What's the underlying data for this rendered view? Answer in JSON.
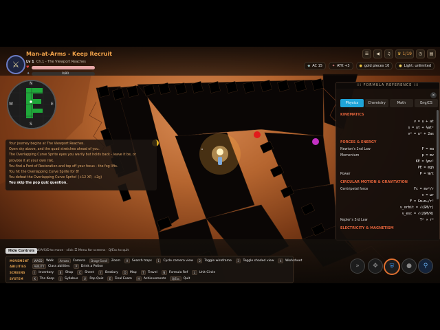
{
  "header": {
    "title": "Man-at-Arms - Keep Recruit",
    "level": "Lv 1",
    "chapter": "Ch.1 - The Viewport Reaches",
    "hp_value": "",
    "xp_value": "0/80",
    "hp_fraction": 1.0,
    "xp_fraction": 0.0,
    "colors": {
      "hp": "#e8a7a7",
      "xp": "#a9c7e0",
      "accent": "#f0a24a"
    }
  },
  "top_icons": [
    {
      "icon": "menu-icon",
      "label": ""
    },
    {
      "icon": "sound-icon",
      "label": ""
    },
    {
      "icon": "music-icon",
      "label": ""
    },
    {
      "icon": "trophy-icon",
      "label": "1/19"
    },
    {
      "icon": "clock-icon",
      "label": ""
    },
    {
      "icon": "book-icon",
      "label": ""
    }
  ],
  "stats": [
    {
      "icon": "shield-icon",
      "label": "AC 15"
    },
    {
      "icon": "sword-icon",
      "label": "ATK +3"
    },
    {
      "icon": "coin-icon",
      "label": "gold pieces 10"
    },
    {
      "icon": "lightbulb-icon",
      "label": "Light: unlimited"
    }
  ],
  "minimap": {
    "n": "N",
    "s": "S",
    "w": "W",
    "e": "E"
  },
  "log": [
    "Your journey begins at The Viewport Reaches.",
    "Open sky above, and the quad stretches ahead of you.",
    "The Overlapping Curve Sprite eyes you warily but holds back - leave it be, or",
    "provoke it at your own risk.",
    "You find a Font of Restoration and top off your focus - the fog lifts.",
    "You hit the Overlapping Curve Sprite for 8!",
    "You defeat the Overlapping Curve Sprite! (+12 XP, +2g)",
    "You skip the pop quiz question."
  ],
  "formula": {
    "header": "FORMULA REFERENCE",
    "close": "×",
    "tabs": [
      "Physics",
      "Chemistry",
      "Math",
      "Eng/CS"
    ],
    "active_tab": 0,
    "sections": [
      {
        "title": "KINEMATICS",
        "rows": [
          {
            "name": "",
            "formula": "v = u + at"
          },
          {
            "name": "",
            "formula": "s = ut + ½at²"
          },
          {
            "name": "",
            "formula": "v² = u² + 2as"
          }
        ]
      },
      {
        "title": "FORCES & ENERGY",
        "rows": [
          {
            "name": "Newton's 2nd Law",
            "formula": "F = ma"
          },
          {
            "name": "Momentum",
            "formula": "p = mv"
          },
          {
            "name": "",
            "formula": "KE = ½mv²"
          },
          {
            "name": "",
            "formula": "PE = mgh"
          },
          {
            "name": "Power",
            "formula": "P = W/t"
          }
        ]
      },
      {
        "title": "CIRCULAR MOTION & GRAVITATION",
        "rows": [
          {
            "name": "Centripetal force",
            "formula": "Fc = mv²/r"
          },
          {
            "name": "",
            "formula": "v = ωr"
          },
          {
            "name": "",
            "formula": "F = Gm₁m₂/r²"
          },
          {
            "name": "",
            "formula": "v_orbit = √(GM/r)"
          },
          {
            "name": "",
            "formula": "v_esc = √(2GM/R)"
          },
          {
            "name": "Kepler's 3rd Law",
            "formula": "T² ∝ r³"
          }
        ]
      },
      {
        "title": "ELECTRICITY & MAGNETISM",
        "rows": []
      }
    ]
  },
  "bottom": {
    "hide_controls": "Hide Controls",
    "hint": "W/A/S/D to move · click ☰ Menu for screens · Q/Esc to quit",
    "rows": [
      {
        "category": "MOVEMENT",
        "items": [
          {
            "key": "WASD",
            "action": "Walk"
          },
          {
            "key": "Arrows",
            "action": "Camera"
          },
          {
            "key": "Drag+Scroll",
            "action": "Zoom"
          },
          {
            "key": "X",
            "action": "Search traps"
          },
          {
            "key": "1",
            "action": "Cycle camera view"
          },
          {
            "key": "2",
            "action": "Toggle wireframe"
          },
          {
            "key": "3",
            "action": "Toggle shaded view"
          },
          {
            "key": "4",
            "action": "Worksheet"
          }
        ]
      },
      {
        "category": "ABILITIES",
        "items": [
          {
            "key": "ABILITY",
            "action": "Class abilities"
          },
          {
            "key": "P",
            "action": "Drink a Potion"
          }
        ]
      },
      {
        "category": "SCREENS",
        "items": [
          {
            "key": "I",
            "action": "Inventory"
          },
          {
            "key": "B",
            "action": "Shop"
          },
          {
            "key": "C",
            "action": "Sheet"
          },
          {
            "key": "Y",
            "action": "Bestiary"
          },
          {
            "key": "O",
            "action": "Map"
          },
          {
            "key": "T",
            "action": "Travel"
          },
          {
            "key": "N",
            "action": "Formula Ref"
          },
          {
            "key": "L",
            "action": "Unit Circle"
          }
        ]
      },
      {
        "category": "SYSTEM",
        "items": [
          {
            "key": "K",
            "action": "The Keep"
          },
          {
            "key": "J",
            "action": "Syllabus"
          },
          {
            "key": "U",
            "action": "Pop Quiz"
          },
          {
            "key": "E",
            "action": "Final Exam"
          },
          {
            "key": "H",
            "action": "Achievements"
          },
          {
            "key": "Q/Esc",
            "action": "Quit"
          }
        ]
      }
    ],
    "abilities": [
      {
        "icon": "speed-icon"
      },
      {
        "icon": "compass-icon"
      },
      {
        "icon": "shield-icon"
      },
      {
        "icon": "potion-icon"
      },
      {
        "icon": "search-icon"
      }
    ]
  }
}
